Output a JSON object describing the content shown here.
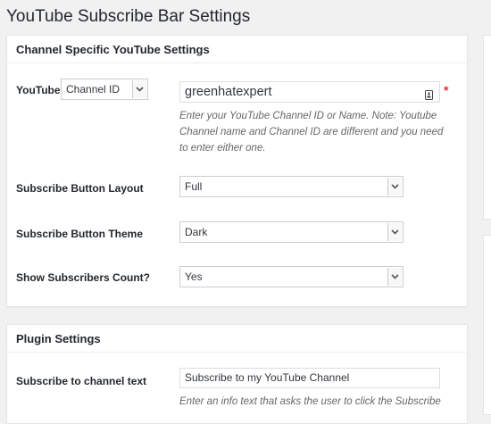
{
  "page": {
    "title": "YouTube Subscribe Bar Settings"
  },
  "channel_section": {
    "title": "Channel Specific YouTube Settings",
    "youtube_label": "YouTube",
    "id_type_select": "Channel ID",
    "channel_value": "greenhatexpert",
    "required_mark": "*",
    "help_lines": [
      "Enter your YouTube Channel ID or Name. Note: Youtube",
      "Channel name and Channel ID are different and you need",
      "to enter either one."
    ],
    "layout_label": "Subscribe Button Layout",
    "layout_value": "Full",
    "theme_label": "Subscribe Button Theme",
    "theme_value": "Dark",
    "count_label": "Show Subscribers Count?",
    "count_value": "Yes"
  },
  "plugin_section": {
    "title": "Plugin Settings",
    "subscribe_text_label": "Subscribe to channel text",
    "subscribe_text_value": "Subscribe to my YouTube Channel",
    "help_line": "Enter an info text that asks the user to click the Subscribe"
  },
  "icons": {
    "dropdown": "chevron-down-icon",
    "field_autofill": "contact-card-icon"
  },
  "colors": {
    "background": "#f1f1f1",
    "panel": "#ffffff",
    "required": "#dc3232",
    "help_text": "#666666"
  }
}
